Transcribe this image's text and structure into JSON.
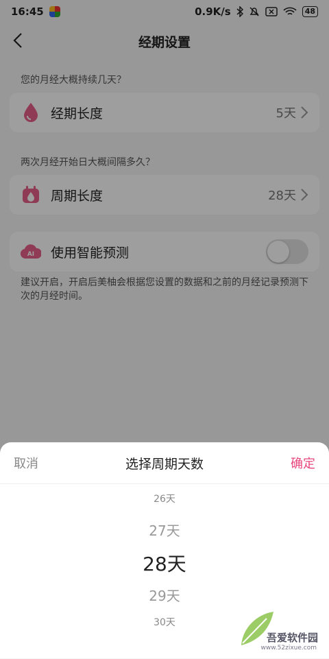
{
  "status": {
    "time": "16:45",
    "speed": "0.9K/s",
    "battery": "48"
  },
  "header": {
    "title": "经期设置"
  },
  "period": {
    "hint": "您的月经大概持续几天？",
    "label": "经期长度",
    "value": "5天"
  },
  "cycle": {
    "hint": "两次月经开始日大概间隔多久？",
    "label": "周期长度",
    "value": "28天"
  },
  "smart": {
    "label": "使用智能预测",
    "enabled": false,
    "note": "建议开启，开启后美柚会根据您设置的数据和之前的月经记录预测下次的月经时间。"
  },
  "sheet": {
    "cancel": "取消",
    "title": "选择周期天数",
    "confirm": "确定",
    "options": [
      "26天",
      "27天",
      "28天",
      "29天",
      "30天"
    ],
    "selected": "28天"
  },
  "watermark": {
    "text": "吾爱软件园",
    "sub": "www.52zixue.com"
  },
  "colors": {
    "accent": "#e8457d",
    "icon_pink": "#e95f8a"
  }
}
